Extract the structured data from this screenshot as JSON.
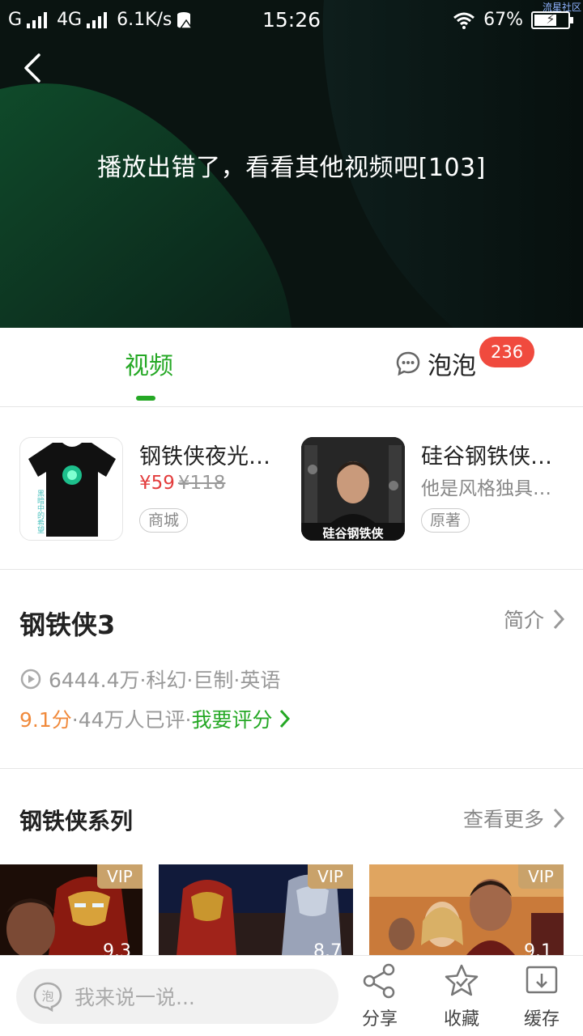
{
  "status_bar": {
    "carrier_1": "G",
    "carrier_2": "4G",
    "speed": "6.1K/s",
    "time": "15:26",
    "battery": "67%",
    "battery_level": 0.67,
    "watermark": "流星社区"
  },
  "player": {
    "error_message": "播放出错了，看看其他视频吧[103]"
  },
  "tabs": {
    "video": "视频",
    "bubble": "泡泡",
    "bubble_badge": "236"
  },
  "products": [
    {
      "title": "钢铁侠夜光…",
      "price": "¥59",
      "old_price": "¥118",
      "tag": "商城",
      "thumb_text": "黑暗中的希望"
    },
    {
      "title": "硅谷钢铁侠…",
      "subtitle": "他是风格独具…",
      "tag": "原著",
      "thumb_text": "硅谷钢铁侠"
    }
  ],
  "movie": {
    "title": "钢铁侠3",
    "intro": "简介",
    "meta": "6444.4万·科幻·巨制·英语",
    "score": "9.1分",
    "rated": "·44万人已评·",
    "rate_action": "我要评分"
  },
  "series": {
    "title": "钢铁侠系列",
    "more": "查看更多",
    "posters": [
      {
        "badge": "VIP",
        "score": "9.3"
      },
      {
        "badge": "VIP",
        "score": "8.7"
      },
      {
        "badge": "VIP",
        "score": "9.1"
      }
    ]
  },
  "bottom_bar": {
    "placeholder": "我来说一说...",
    "bubble_icon_text": "泡",
    "share": "分享",
    "favorite": "收藏",
    "cache": "缓存"
  },
  "colors": {
    "accent_green": "#25a825",
    "badge_red": "#f04a3e",
    "price_red": "#e33d3d",
    "score_orange": "#f08a3c",
    "vip_gold": "#c9a26a"
  }
}
